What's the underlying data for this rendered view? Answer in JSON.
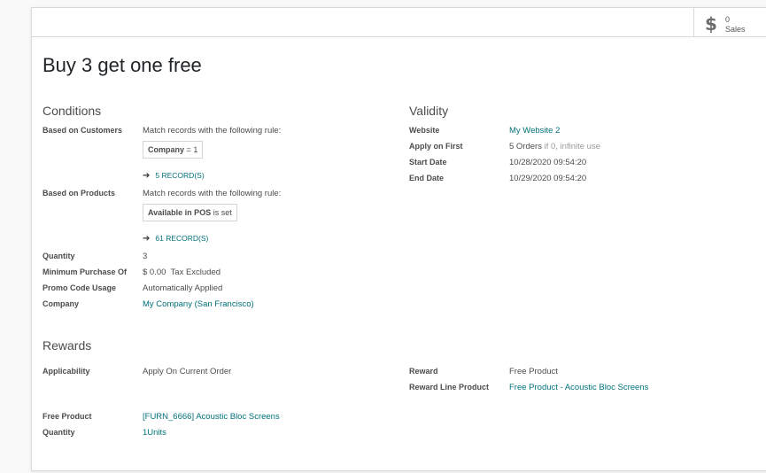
{
  "stat_button": {
    "icon": "dollar-icon",
    "value": "0",
    "label": "Sales"
  },
  "title": "Buy 3 get one free",
  "conditions": {
    "title": "Conditions",
    "based_on_customers": {
      "label": "Based on Customers",
      "rule_text": "Match records with the following rule:",
      "field": "Company",
      "operator": "=",
      "value": "1",
      "records": "5 RECORD(S)"
    },
    "based_on_products": {
      "label": "Based on Products",
      "rule_text": "Match records with the following rule:",
      "field": "Available in POS",
      "operator": "is set",
      "records": "61 RECORD(S)"
    },
    "quantity": {
      "label": "Quantity",
      "value": "3"
    },
    "minimum_purchase": {
      "label": "Minimum Purchase Of",
      "amount": "$ 0.00",
      "tax": "Tax Excluded"
    },
    "promo_code_usage": {
      "label": "Promo Code Usage",
      "value": "Automatically Applied"
    },
    "company": {
      "label": "Company",
      "value": "My Company (San Francisco)"
    }
  },
  "validity": {
    "title": "Validity",
    "website": {
      "label": "Website",
      "value": "My Website 2"
    },
    "apply_on_first": {
      "label": "Apply on First",
      "value": "5 Orders",
      "hint": "if 0, infinite use"
    },
    "start_date": {
      "label": "Start Date",
      "value": "10/28/2020 09:54:20"
    },
    "end_date": {
      "label": "End Date",
      "value": "10/29/2020 09:54:20"
    }
  },
  "rewards": {
    "title": "Rewards",
    "applicability": {
      "label": "Applicability",
      "value": "Apply On Current Order"
    },
    "reward": {
      "label": "Reward",
      "value": "Free Product"
    },
    "reward_line_product": {
      "label": "Reward Line Product",
      "value": "Free Product - Acoustic Bloc Screens"
    },
    "free_product": {
      "label": "Free Product",
      "value": "[FURN_6666] Acoustic Bloc Screens"
    },
    "quantity": {
      "label": "Quantity",
      "value": "1Units"
    }
  },
  "colors": {
    "link": "#00717a",
    "text": "#4c4c4c",
    "title": "#212529"
  }
}
